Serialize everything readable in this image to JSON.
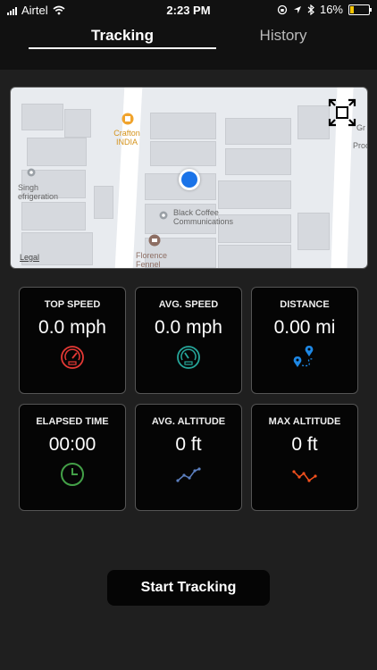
{
  "status_bar": {
    "carrier": "Airtel",
    "time": "2:23 PM",
    "battery": "16%"
  },
  "tabs": [
    {
      "label": "Tracking",
      "active": true
    },
    {
      "label": "History",
      "active": false
    }
  ],
  "map": {
    "poi": {
      "name": "Crafton",
      "sub": "INDIA"
    },
    "labels": {
      "singh_line1": "Singh",
      "singh_line2": "efrigeration",
      "black_coffee_line1": "Black Coffee",
      "black_coffee_line2": "Communications",
      "florence_line1": "Florence",
      "florence_line2": "Fennel",
      "edge_top": "Gr",
      "edge_bottom": "Proc"
    },
    "legal": "Legal"
  },
  "stats": [
    {
      "title": "TOP SPEED",
      "value": "0.0 mph",
      "icon": "speedometer-icon",
      "color": "#e53935"
    },
    {
      "title": "AVG. SPEED",
      "value": "0.0 mph",
      "icon": "gauge-icon",
      "color": "#26a69a"
    },
    {
      "title": "DISTANCE",
      "value": "0.00 mi",
      "icon": "route-pins-icon",
      "color": "#1e88e5"
    },
    {
      "title": "ELAPSED TIME",
      "value": "00:00",
      "icon": "clock-icon",
      "color": "#43a047"
    },
    {
      "title": "AVG. ALTITUDE",
      "value": "0 ft",
      "icon": "altitude-line-icon",
      "color": "#5c7fbf"
    },
    {
      "title": "MAX ALTITUDE",
      "value": "0 ft",
      "icon": "max-altitude-line-icon",
      "color": "#f4511e"
    }
  ],
  "start_button": "Start Tracking"
}
